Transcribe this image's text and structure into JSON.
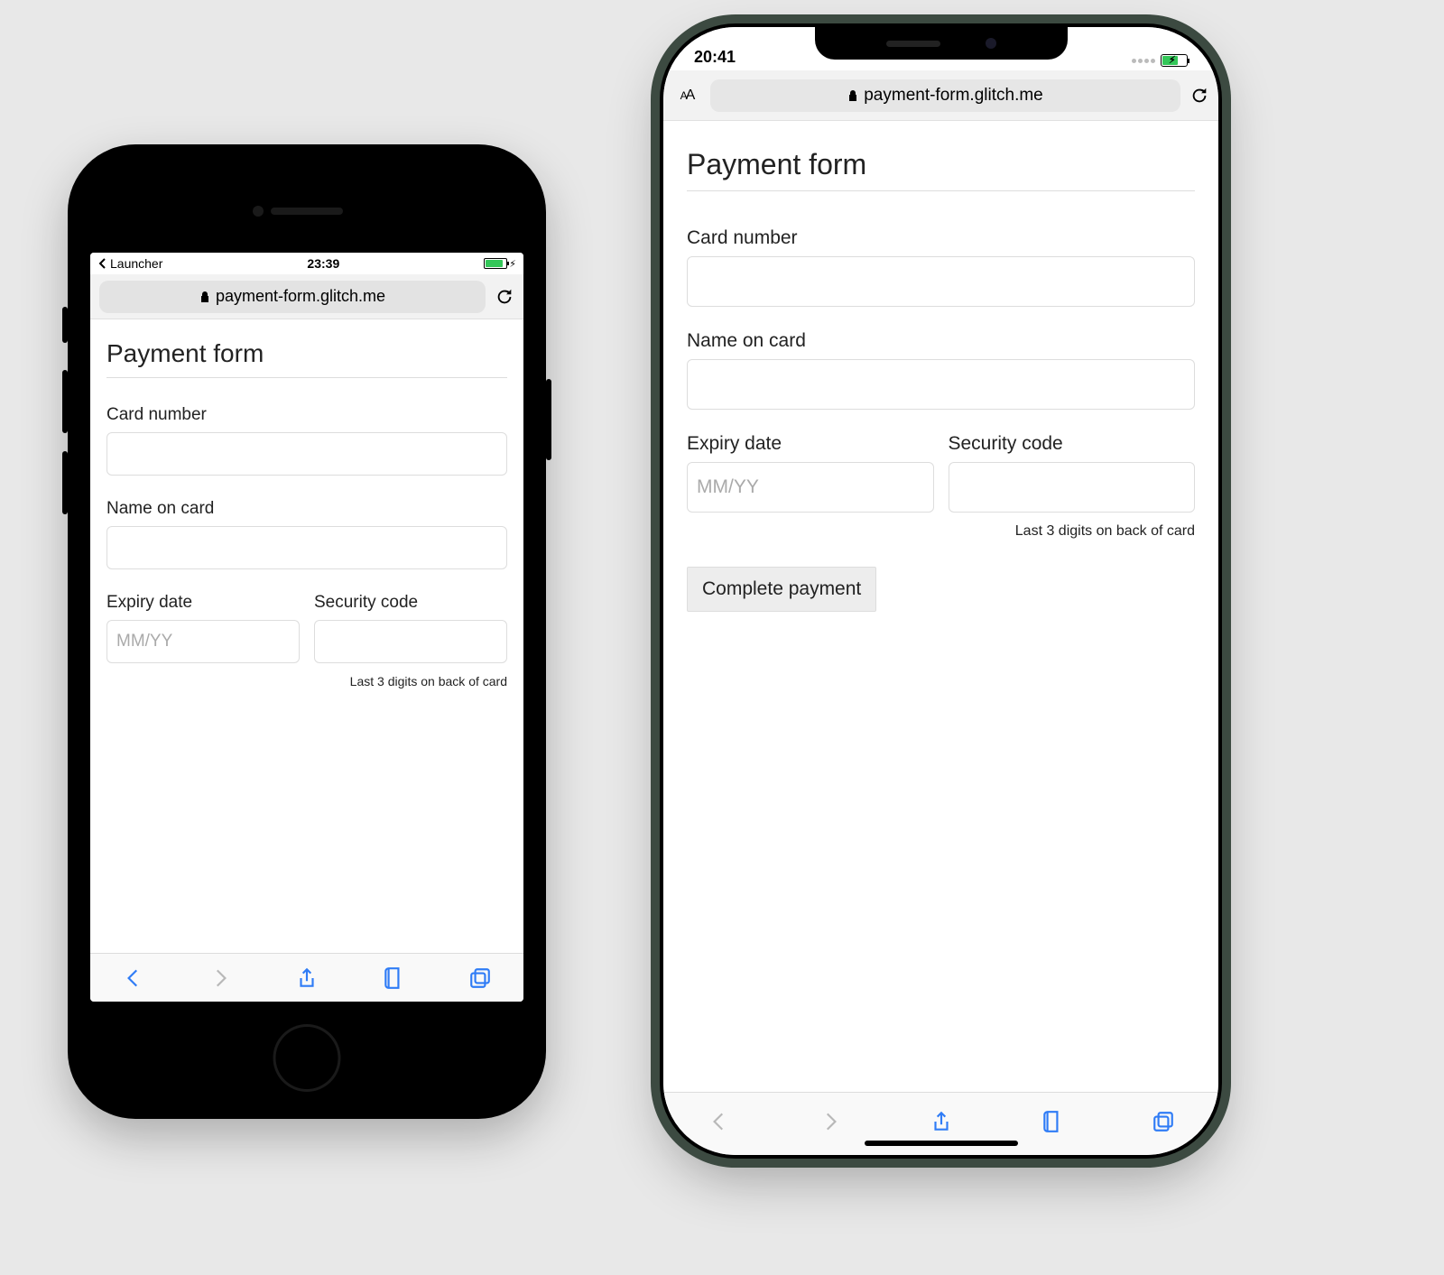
{
  "left": {
    "status": {
      "back_label": "Launcher",
      "time": "23:39"
    },
    "url": "payment-form.glitch.me",
    "page": {
      "heading": "Payment form",
      "card_label": "Card number",
      "name_label": "Name on card",
      "expiry_label": "Expiry date",
      "expiry_placeholder": "MM/YY",
      "cvc_label": "Security code",
      "cvc_hint": "Last 3 digits on back of card"
    }
  },
  "right": {
    "status": {
      "time": "20:41"
    },
    "aa_label": "AA",
    "url": "payment-form.glitch.me",
    "page": {
      "heading": "Payment form",
      "card_label": "Card number",
      "name_label": "Name on card",
      "expiry_label": "Expiry date",
      "expiry_placeholder": "MM/YY",
      "cvc_label": "Security code",
      "cvc_hint": "Last 3 digits on back of card",
      "submit_label": "Complete payment"
    }
  }
}
